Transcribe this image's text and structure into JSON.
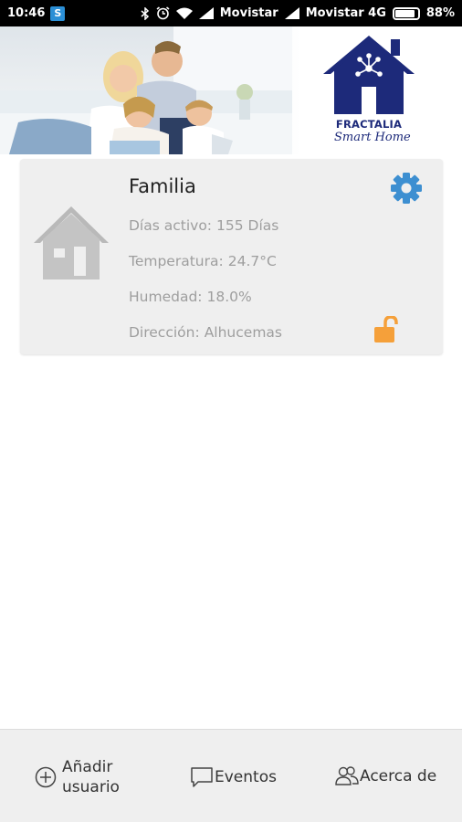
{
  "status_bar": {
    "time": "10:46",
    "app_icon_letter": "S",
    "carrier1": "Movistar",
    "carrier2": "Movistar 4G",
    "battery": "88%",
    "battery_level": 0.88
  },
  "banner": {
    "brand": "FRACTALIA",
    "tagline": "Smart Home",
    "page_count": 2,
    "active_page": 1,
    "brand_color": "#1d2a7a"
  },
  "home_card": {
    "title": "Familia",
    "days_label": "Días activo:",
    "days_value": "155 Días",
    "temp_label": "Temperatura:",
    "temp_value": "24.7°C",
    "humidity_label": "Humedad:",
    "humidity_value": "18.0%",
    "address_label": "Dirección:",
    "address_value": "Alhucemas",
    "accent_gear": "#3d8fd1",
    "accent_lock": "#f5a03a",
    "icons": {
      "home": "house-icon",
      "settings": "gear-icon",
      "lock": "unlocked-padlock-icon"
    }
  },
  "bottom_nav": {
    "add_user_line1": "Añadir",
    "add_user_line2": "usuario",
    "events": "Eventos",
    "about": "Acerca de"
  }
}
